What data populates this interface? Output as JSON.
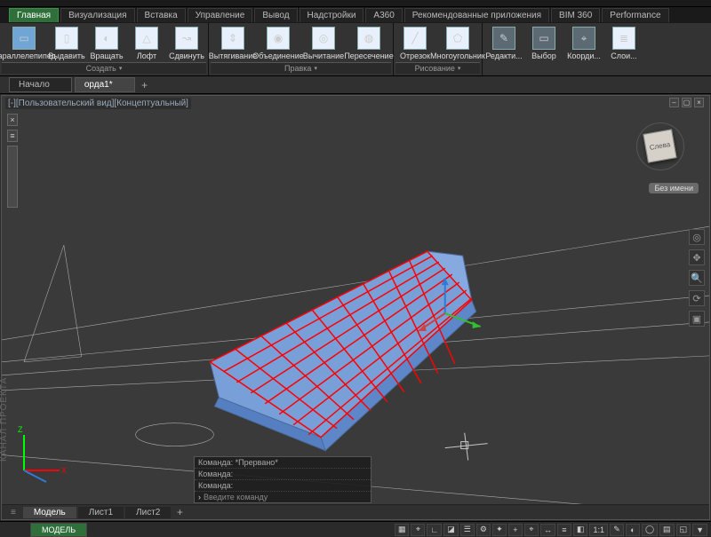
{
  "tabs": [
    "Главная",
    "Визуализация",
    "Вставка",
    "Управление",
    "Вывод",
    "Надстройки",
    "A360",
    "Рекомендованные приложения",
    "BIM 360",
    "Performance"
  ],
  "active_tab_index": 0,
  "ribbon": {
    "panels": [
      {
        "title": "Создать",
        "items": [
          {
            "label": "Параллелепипед",
            "icon": "box"
          },
          {
            "label": "Выдавить",
            "icon": "extrude"
          },
          {
            "label": "Вращать",
            "icon": "revolve"
          },
          {
            "label": "Лофт",
            "icon": "loft"
          },
          {
            "label": "Сдвинуть",
            "icon": "sweep"
          }
        ]
      },
      {
        "title": "Правка",
        "items": [
          {
            "label": "Вытягивание",
            "icon": "presspull"
          },
          {
            "label": "Объединение",
            "icon": "union"
          },
          {
            "label": "Вычитание",
            "icon": "subtract"
          },
          {
            "label": "Пересечение",
            "icon": "intersect"
          }
        ]
      },
      {
        "title": "Рисование",
        "items": [
          {
            "label": "Отрезок",
            "icon": "line"
          },
          {
            "label": "Многоугольник",
            "icon": "polygon"
          }
        ]
      },
      {
        "title": "",
        "items": [
          {
            "label": "Редакти...",
            "icon": "edit"
          },
          {
            "label": "Выбор",
            "icon": "select"
          },
          {
            "label": "Коорди...",
            "icon": "coord"
          },
          {
            "label": "Слои...",
            "icon": "layers"
          }
        ]
      }
    ]
  },
  "filetabs": {
    "items": [
      "Начало",
      "орда1*"
    ],
    "active": 1
  },
  "viewport": {
    "label": "[-][Пользовательский вид][Концептуальный]",
    "viewcube_face": "Слева",
    "pill": "Без имени"
  },
  "command": {
    "history": [
      "Команда: *Прервано*",
      "Команда:",
      "Команда:"
    ],
    "prompt": "Введите команду"
  },
  "layouts": {
    "items": [
      "Модель",
      "Лист1",
      "Лист2"
    ],
    "active": 0
  },
  "statusbar": {
    "model": "МОДЕЛЬ",
    "icons": [
      "▦",
      "⌖",
      "∟",
      "◪",
      "☰",
      "⚙",
      "✦",
      "+",
      "⌖",
      "↔",
      "≡",
      "◧",
      "1:1",
      "✎",
      "◐",
      "◯",
      "▤",
      "◱",
      "▼"
    ]
  },
  "project_label": "КАНАЛ ПРОЕКТА"
}
